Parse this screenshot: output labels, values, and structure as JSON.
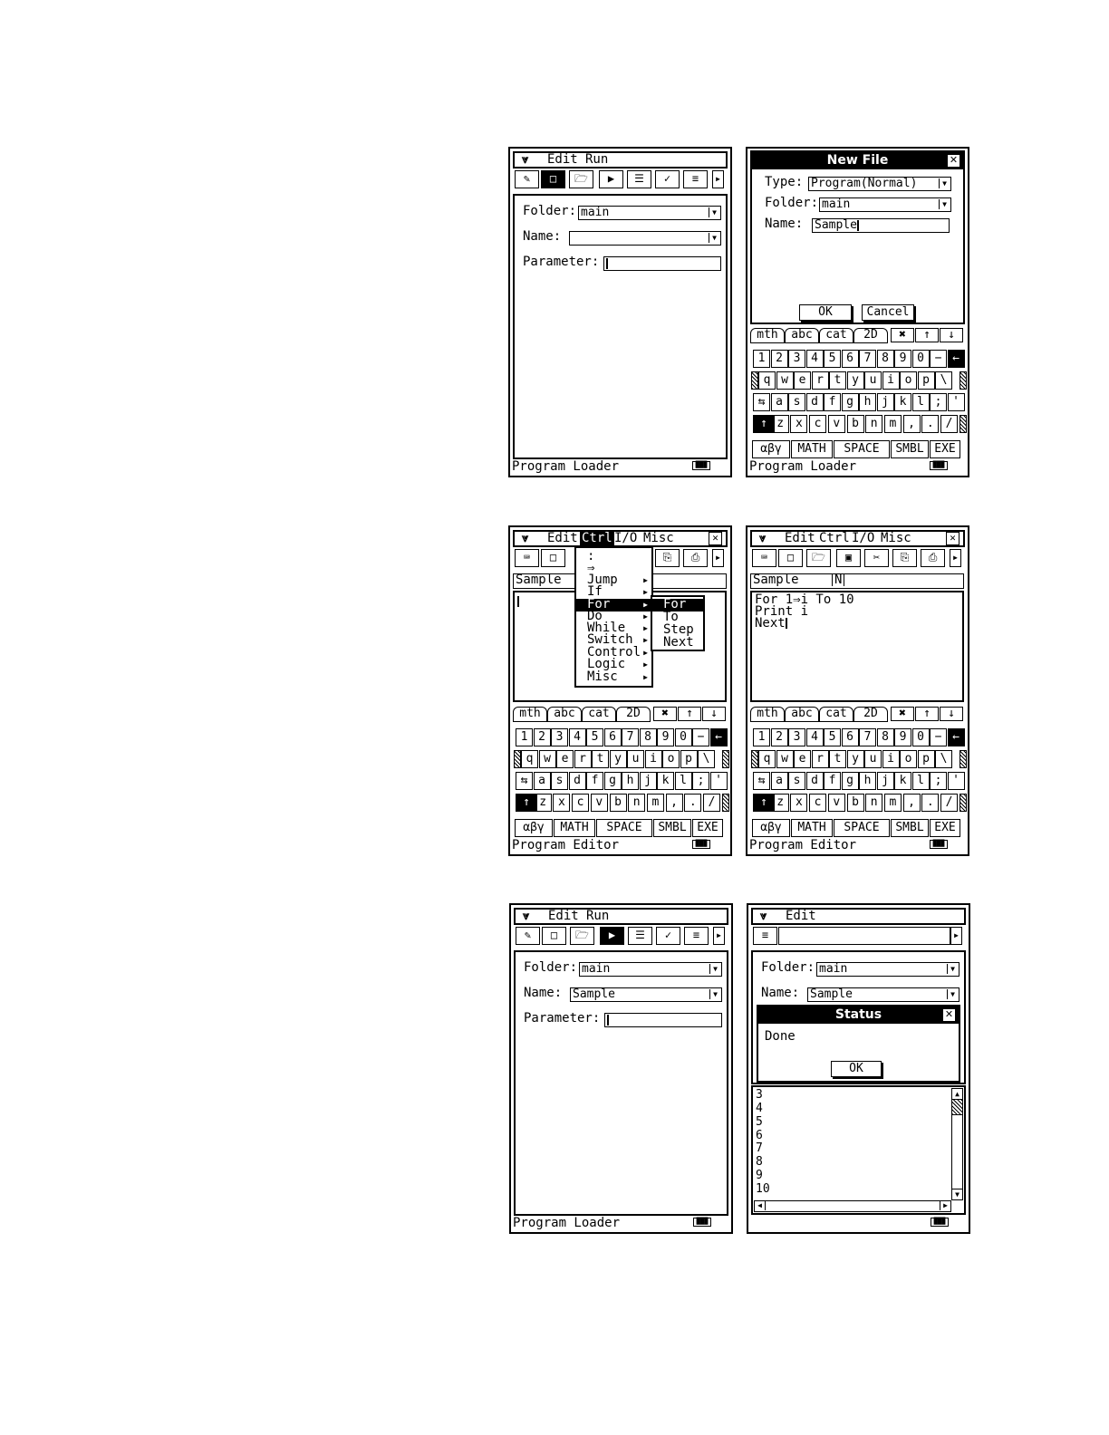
{
  "screens": {
    "s1": {
      "menu": [
        "Edit",
        "Run"
      ],
      "toolbar": [
        "edit-icon",
        "new-file-icon",
        "open-folder-icon",
        "run-icon",
        "text-icon",
        "check-icon",
        "list-icon"
      ],
      "folder_label": "Folder:",
      "folder_value": "main",
      "name_label": "Name:",
      "name_value": "",
      "param_label": "Parameter:",
      "status": "Program Loader"
    },
    "s2": {
      "dialog_title": "New File",
      "type_label": "Type:",
      "type_value": "Program(Normal)",
      "folder_label": "Folder:",
      "folder_value": "main",
      "name_label": "Name:",
      "name_value": "Sample",
      "ok": "OK",
      "cancel": "Cancel",
      "status": "Program Loader"
    },
    "s3": {
      "menu": [
        "Edit",
        "Ctrl",
        "I/O",
        "Misc"
      ],
      "selected_menu": "Ctrl",
      "file_name": "Sample",
      "ctrl_items": [
        ":",
        "⇒",
        "Jump",
        "If",
        "For",
        "Do",
        "While",
        "Switch",
        "Control",
        "Logic",
        "Misc"
      ],
      "for_items": [
        "For",
        "To",
        "Step",
        "Next"
      ],
      "status": "Program Editor"
    },
    "s4": {
      "menu": [
        "Edit",
        "Ctrl",
        "I/O",
        "Misc"
      ],
      "file_name": "Sample",
      "mode_flag": "N",
      "code": [
        "For 1⇒i To 10",
        "Print i",
        "Next"
      ],
      "status": "Program Editor"
    },
    "s5": {
      "menu": [
        "Edit",
        "Run"
      ],
      "folder_label": "Folder:",
      "folder_value": "main",
      "name_label": "Name:",
      "name_value": "Sample",
      "param_label": "Parameter:",
      "status": "Program Loader"
    },
    "s6": {
      "menu": [
        "Edit"
      ],
      "folder_label": "Folder:",
      "folder_value": "main",
      "name_label": "Name:",
      "name_value": "Sample",
      "dialog_title": "Status",
      "dialog_text": "Done",
      "ok": "OK",
      "output": [
        "3",
        "4",
        "5",
        "6",
        "7",
        "8",
        "9",
        "10"
      ]
    }
  },
  "keyboard": {
    "tabs": [
      "mth",
      "abc",
      "cat",
      "2D"
    ],
    "row1": [
      "1",
      "2",
      "3",
      "4",
      "5",
      "6",
      "7",
      "8",
      "9",
      "0",
      "−",
      "←"
    ],
    "row2": [
      "q",
      "w",
      "e",
      "r",
      "t",
      "y",
      "u",
      "i",
      "o",
      "p",
      "\\"
    ],
    "row3": [
      "⇆",
      "a",
      "s",
      "d",
      "f",
      "g",
      "h",
      "j",
      "k",
      "l",
      ";",
      "'"
    ],
    "row4": [
      "↑",
      "z",
      "x",
      "c",
      "v",
      "b",
      "n",
      "m",
      ",",
      ".",
      "/"
    ],
    "bottom": [
      "αβγ",
      "MATH",
      "SPACE",
      "SMBL",
      "EXE"
    ]
  }
}
